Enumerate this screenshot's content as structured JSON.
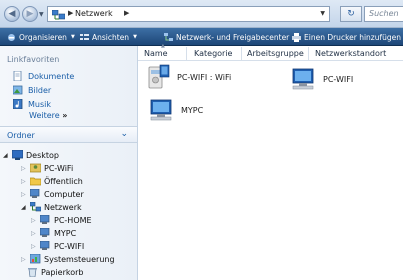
{
  "address": {
    "path": "Netzwerk",
    "search_placeholder": "Suchen"
  },
  "toolbar": {
    "organize": "Organisieren",
    "views": "Ansichten",
    "network_center": "Netzwerk- und Freigabecenter",
    "add_printer": "Einen Drucker hinzufügen"
  },
  "nav": {
    "favorites_header": "Linkfavoriten",
    "favorites": [
      "Dokumente",
      "Bilder",
      "Musik"
    ],
    "more": "Weitere",
    "more_arrows": "»",
    "folders_header": "Ordner",
    "tree": [
      "Desktop",
      "PC-WiFi",
      "Öffentlich",
      "Computer",
      "Netzwerk",
      "PC-HOME",
      "MYPC",
      "PC-WIFI",
      "Systemsteuerung",
      "Papierkorb"
    ]
  },
  "columns": [
    "Name",
    "Kategorie",
    "Arbeitsgruppe",
    "Netzwerkstandort"
  ],
  "items": [
    "PC-WIFI : WiFi",
    "PC-WIFI",
    "MYPC"
  ],
  "colors": {
    "toolbar": "#1d4677",
    "link": "#1a5ea8"
  }
}
